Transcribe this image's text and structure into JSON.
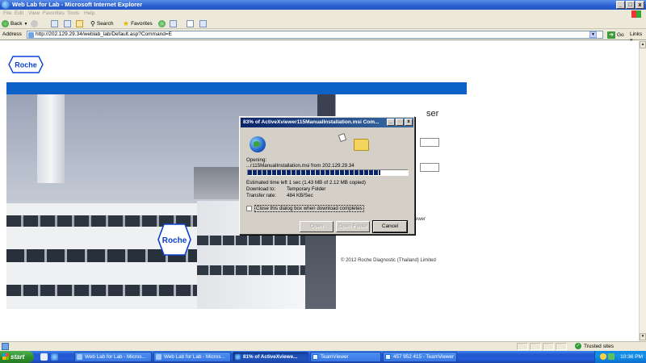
{
  "window": {
    "title": "Web Lab for Lab - Microsoft Internet Explorer",
    "controls": {
      "minimize": "_",
      "maximize": "□",
      "close": "x"
    }
  },
  "menu": [
    "File",
    "Edit",
    "View",
    "Favorites",
    "Tools",
    "Help"
  ],
  "toolbar": {
    "back": "Back",
    "search": "Search",
    "favorites": "Favorites"
  },
  "address": {
    "label": "Address",
    "url": "http://202.129.29.34/weblab_lab/Default.asp?Command=E",
    "go": "Go",
    "links": "Links »"
  },
  "page": {
    "logo_text": "Roche",
    "building_logo_text": "Roche",
    "login_heading_fragment": "ser",
    "side_fragment": "ewer",
    "copyright": "© 2012 Roche Diagnostic (Thailand) Limited"
  },
  "dialog": {
    "title": "83% of ActiveXviewer115ManualInstallation.msi Com...",
    "opening_label": "Opening:",
    "file_line": "...r115ManualInstallation.msi from 202.129.29.34",
    "progress": 0.83,
    "time_left_label": "Estimated time left",
    "time_left_value": "1 sec (1.43 MB of 2.12 MB copied)",
    "download_to_label": "Download to:",
    "download_to_value": "Temporary Folder",
    "rate_label": "Transfer rate:",
    "rate_value": "484 KB/Sec",
    "close_checkbox_label": "Close this dialog box when download completes",
    "close_checkbox_checked": false,
    "open_button": "Open",
    "open_folder_button": "Open Folder",
    "cancel_button": "Cancel"
  },
  "statusbar": {
    "zone": "Trusted sites"
  },
  "taskbar": {
    "start": "start",
    "tasks": [
      "Web Lab for Lab - Micros...",
      "Web Lab for Lab - Micros...",
      "81% of ActiveXviewe...",
      "TeamViewer",
      "457 952 415 - TeamViewer"
    ],
    "clock": "10:36 PM"
  }
}
